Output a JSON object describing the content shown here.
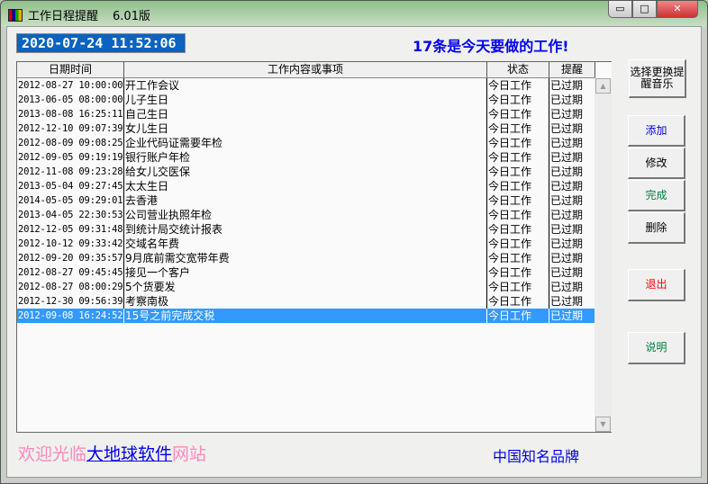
{
  "window": {
    "title": "工作日程提醒",
    "version": "6.01版",
    "minimize": "▭",
    "maximize": "□",
    "close": "✕"
  },
  "clock": "2020-07-24 11:52:06",
  "headline": "17条是今天要做的工作!",
  "table": {
    "headers": [
      "日期时间",
      "工作内容或事项",
      "状态",
      "提醒"
    ],
    "rows": [
      [
        "2012-08-27 10:00:00",
        "开工作会议",
        "今日工作",
        "已过期"
      ],
      [
        "2013-06-05 08:00:00",
        "儿子生日",
        "今日工作",
        "已过期"
      ],
      [
        "2013-08-08 16:25:11",
        "自己生日",
        "今日工作",
        "已过期"
      ],
      [
        "2012-12-10 09:07:39",
        "女儿生日",
        "今日工作",
        "已过期"
      ],
      [
        "2012-08-09 09:08:25",
        "企业代码证需要年检",
        "今日工作",
        "已过期"
      ],
      [
        "2012-09-05 09:19:19",
        "银行账户年检",
        "今日工作",
        "已过期"
      ],
      [
        "2012-11-08 09:23:28",
        "给女儿交医保",
        "今日工作",
        "已过期"
      ],
      [
        "2013-05-04 09:27:45",
        "太太生日",
        "今日工作",
        "已过期"
      ],
      [
        "2014-05-05 09:29:01",
        "去香港",
        "今日工作",
        "已过期"
      ],
      [
        "2013-04-05 22:30:53",
        "公司营业执照年检",
        "今日工作",
        "已过期"
      ],
      [
        "2012-12-05 09:31:48",
        "到统计局交统计报表",
        "今日工作",
        "已过期"
      ],
      [
        "2012-10-12 09:33:42",
        "交域名年费",
        "今日工作",
        "已过期"
      ],
      [
        "2012-09-20 09:35:57",
        "9月底前需交宽带年费",
        "今日工作",
        "已过期"
      ],
      [
        "2012-08-27 09:45:45",
        "接见一个客户",
        "今日工作",
        "已过期"
      ],
      [
        "2012-08-27 08:00:29",
        "5个货要发",
        "今日工作",
        "已过期"
      ],
      [
        "2012-12-30 09:56:39",
        "考察南极",
        "今日工作",
        "已过期"
      ],
      [
        "2012-09-08 16:24:52",
        "15号之前完成交税",
        "今日工作",
        "已过期"
      ]
    ],
    "selected_index": 16
  },
  "buttons": {
    "music": "选择更换提醒音乐",
    "add": "添加",
    "edit": "修改",
    "done": "完成",
    "delete": "删除",
    "exit": "退出",
    "help": "说明"
  },
  "colors": {
    "add": "#0000ee",
    "done": "#008040",
    "exit": "#ff0000",
    "help": "#008040"
  },
  "footer": {
    "welcome_prefix": "欢迎光临",
    "link": "大地球软件",
    "welcome_suffix": "网站",
    "brand": "中国知名品牌"
  }
}
